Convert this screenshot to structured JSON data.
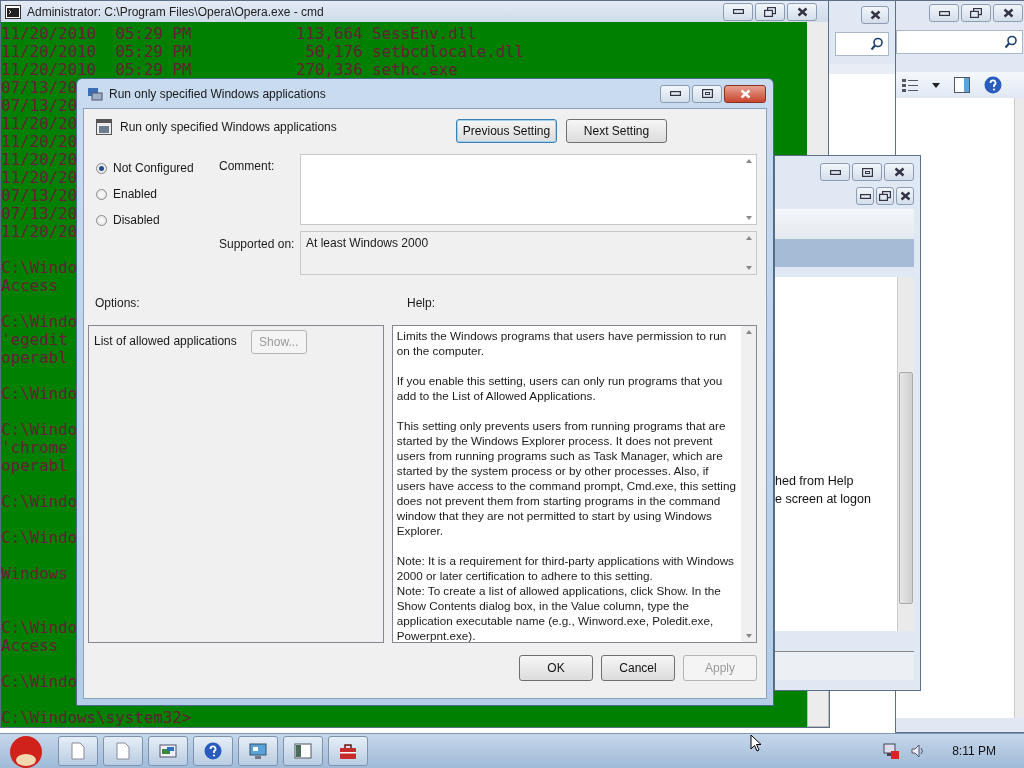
{
  "cmd_window": {
    "title": "Administrator: C:\\Program Files\\Opera\\Opera.exe - cmd",
    "lines": [
      {
        "kind": "text",
        "text": "11/20/2010  05:29 PM           113,664 SessEnv.dll"
      },
      {
        "kind": "text",
        "text": "11/20/2010  05:29 PM            50,176 setbcdlocale.dll"
      },
      {
        "kind": "text",
        "text": "11/20/2010  05:29 PM           270,336 sethc.exe"
      },
      {
        "kind": "text",
        "text": "07/13/20"
      },
      {
        "kind": "text",
        "text": "07/13/20"
      },
      {
        "kind": "text",
        "text": "11/20/20"
      },
      {
        "kind": "text",
        "text": "11/20/20"
      },
      {
        "kind": "text",
        "text": "11/20/20"
      },
      {
        "kind": "text",
        "text": "11/20/20"
      },
      {
        "kind": "text",
        "text": "07/13/20"
      },
      {
        "kind": "text",
        "text": "07/13/20"
      },
      {
        "kind": "text",
        "text": "11/20/20"
      },
      {
        "kind": "blank"
      },
      {
        "kind": "text",
        "text": "C:\\Windo"
      },
      {
        "kind": "text",
        "text": "Access"
      },
      {
        "kind": "blank"
      },
      {
        "kind": "text",
        "text": "C:\\Windo"
      },
      {
        "kind": "text",
        "text": "'egedit"
      },
      {
        "kind": "text",
        "text": "operabl"
      },
      {
        "kind": "blank"
      },
      {
        "kind": "text",
        "text": "C:\\Windo"
      },
      {
        "kind": "blank"
      },
      {
        "kind": "text",
        "text": "C:\\Windo"
      },
      {
        "kind": "text",
        "text": "'chrome"
      },
      {
        "kind": "text",
        "text": "operabl"
      },
      {
        "kind": "blank"
      },
      {
        "kind": "text",
        "text": "C:\\Windo"
      },
      {
        "kind": "blank"
      },
      {
        "kind": "text",
        "text": "C:\\Windo"
      },
      {
        "kind": "blank"
      },
      {
        "kind": "text",
        "text": "Windows"
      },
      {
        "kind": "blank"
      },
      {
        "kind": "blank"
      },
      {
        "kind": "text",
        "text": "C:\\Windo"
      },
      {
        "kind": "text",
        "text": "Access"
      },
      {
        "kind": "blank"
      },
      {
        "kind": "text",
        "text": "C:\\Windo"
      },
      {
        "kind": "blank"
      },
      {
        "kind": "text",
        "text": "C:\\Windows\\system32>"
      }
    ]
  },
  "editor_window": {
    "lines": [
      "hed from Help",
      "e screen at logon"
    ]
  },
  "dialog": {
    "title": "Run only specified Windows applications",
    "setting_title": "Run only specified Windows applications",
    "nav_buttons": [
      {
        "label": "Previous Setting",
        "focused": true
      },
      {
        "label": "Next Setting",
        "focused": false
      }
    ],
    "states": [
      {
        "label": "Not Configured",
        "selected": true
      },
      {
        "label": "Enabled",
        "selected": false
      },
      {
        "label": "Disabled",
        "selected": false
      }
    ],
    "comment_label": "Comment:",
    "supported_label": "Supported on:",
    "supported_value": "At least Windows 2000",
    "options_label": "Options:",
    "help_label": "Help:",
    "options": [
      {
        "label": "List of allowed applications",
        "button": {
          "label": "Show...",
          "disabled": true
        }
      }
    ],
    "help_blocks": [
      [
        "Limits the Windows programs that users have permission to run on the computer."
      ],
      [
        "If you enable this setting, users can only run programs that you add to the List of Allowed Applications."
      ],
      [
        "This setting only prevents users from running programs that are started by the Windows Explorer process. It does not prevent users from running programs such as Task Manager, which are started by the system process or by other processes. Also, if users have access to the command prompt, Cmd.exe, this setting does not prevent them from starting programs in the command window that they are not permitted to start by using Windows Explorer."
      ],
      [
        "Note: It is a requirement for third-party applications with Windows 2000 or later certification to adhere to this setting.",
        "Note: To create a list of allowed applications, click Show. In the Show Contents dialog box, in the Value column, type the application executable name (e.g., Winword.exe, Poledit.exe, Powerpnt.exe)."
      ]
    ],
    "buttons": [
      {
        "label": "OK",
        "disabled": false
      },
      {
        "label": "Cancel",
        "disabled": false
      },
      {
        "label": "Apply",
        "disabled": true
      }
    ]
  },
  "taskbar": {
    "clock": "8:11 PM"
  }
}
